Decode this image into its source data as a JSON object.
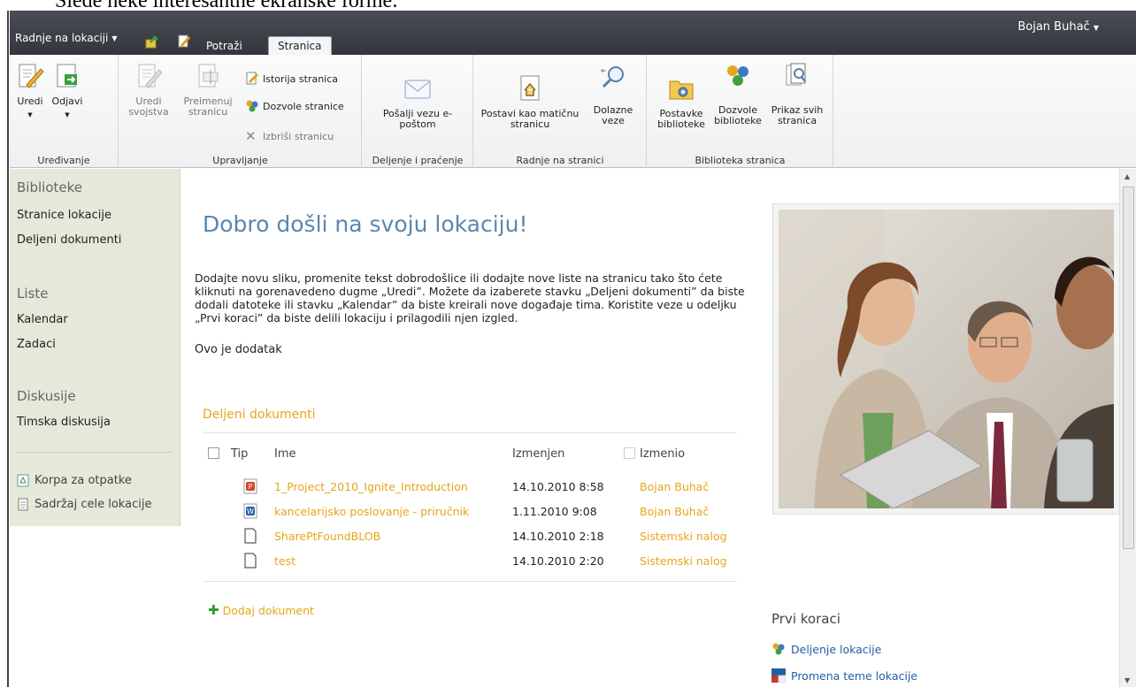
{
  "caption": "Slede neke interesantne ekranske forme:",
  "topbar": {
    "site_actions": "Radnje na lokaciji",
    "tabs": [
      {
        "label": "Potraži"
      },
      {
        "label": "Stranica"
      }
    ],
    "user": "Bojan Buhač"
  },
  "ribbon": {
    "groups": [
      {
        "label": "Uređivanje",
        "buttons": [
          "Uredi",
          "Odjavi"
        ]
      },
      {
        "label": "Upravljanje",
        "buttons": [
          "Uredi svojstva",
          "Preimenuj stranicu",
          "Istorija stranica",
          "Dozvole stranice",
          "Izbriši stranicu"
        ]
      },
      {
        "label": "Deljenje i praćenje",
        "buttons": [
          "Pošalji vezu e-poštom"
        ]
      },
      {
        "label": "Radnje na stranici",
        "buttons": [
          "Postavi kao matičnu stranicu",
          "Dolazne veze"
        ]
      },
      {
        "label": "Biblioteka stranica",
        "buttons": [
          "Postavke biblioteke",
          "Dozvole biblioteke",
          "Prikaz svih stranica"
        ]
      }
    ]
  },
  "quicklaunch": {
    "sections": [
      {
        "heading": "Biblioteke",
        "items": [
          "Stranice lokacije",
          "Deljeni dokumenti"
        ]
      },
      {
        "heading": "Liste",
        "items": [
          "Kalendar",
          "Zadaci"
        ]
      },
      {
        "heading": "Diskusije",
        "items": [
          "Timska diskusija"
        ]
      }
    ],
    "bottom": [
      "Korpa za otpatke",
      "Sadržaj cele lokacije"
    ]
  },
  "main": {
    "title": "Dobro došli na svoju lokaciju!",
    "welcome": "Dodajte novu sliku, promenite tekst dobrodošlice ili dodajte nove liste na stranicu tako što ćete kliknuti na gorenavedeno dugme „Uredi”. Možete da izaberete stavku „Deljeni dokumenti” da biste dodali datoteke ili stavku „Kalendar” da biste kreirali nove događaje tima. Koristite veze u odeljku „Prvi koraci” da biste delili lokaciju i prilagodili njen izgled.",
    "addendum": "Ovo je dodatak",
    "docs": {
      "title": "Deljeni dokumenti",
      "columns": [
        "Tip",
        "Ime",
        "Izmenjen",
        "Izmenio"
      ],
      "rows": [
        {
          "type": "ppt-icon",
          "name": "1_Project_2010_Ignite_Introduction",
          "modified": "14.10.2010 8:58",
          "by": "Bojan Buhač"
        },
        {
          "type": "word-icon",
          "name": "kancelarijsko poslovanje - priručnik",
          "modified": "1.11.2010 9:08",
          "by": "Bojan Buhač"
        },
        {
          "type": "file-icon",
          "name": "SharePtFoundBLOB",
          "modified": "14.10.2010 2:18",
          "by": "Sistemski nalog"
        },
        {
          "type": "file-icon",
          "name": "test",
          "modified": "14.10.2010 2:20",
          "by": "Sistemski nalog"
        }
      ],
      "add_label": "Dodaj dokument"
    },
    "first_steps": {
      "title": "Prvi koraci",
      "links": [
        "Deljenje lokacije",
        "Promena teme lokacije"
      ]
    }
  },
  "colors": {
    "accent": "#e5a61a",
    "title": "#5a87b0",
    "topbar": "#3b3e45",
    "quicklaunch": "#e4e9d9"
  }
}
